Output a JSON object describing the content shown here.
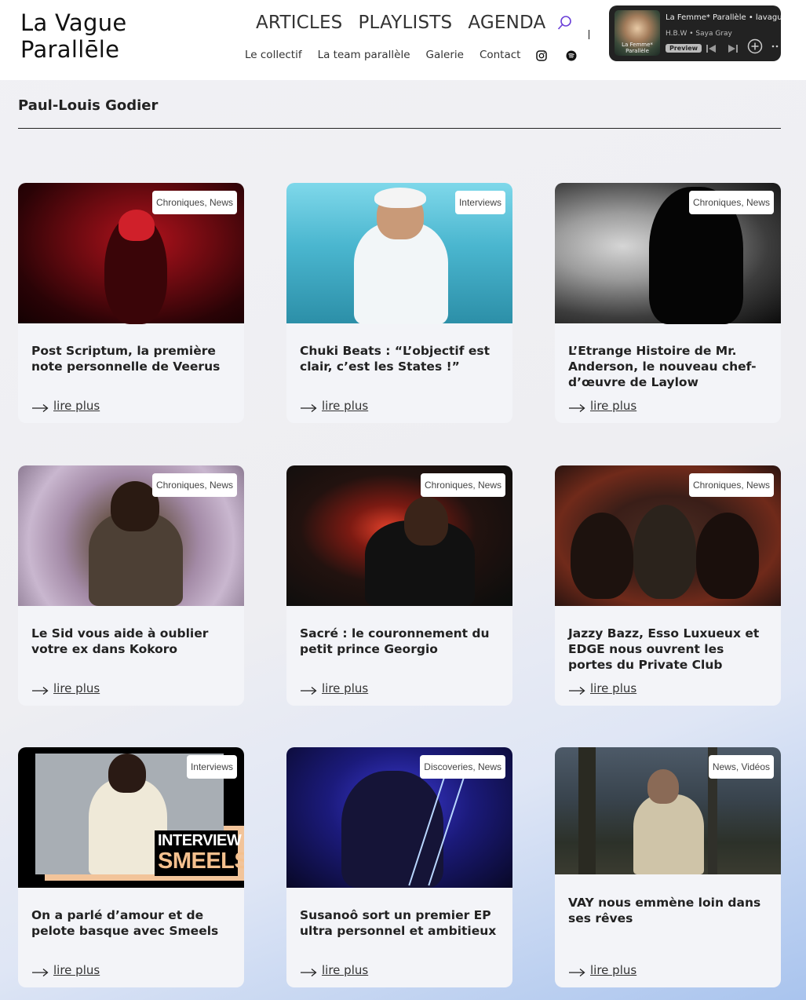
{
  "header": {
    "logo_line1": "La Vague",
    "logo_line2": "Parallēle",
    "main_nav": [
      "ARTICLES",
      "PLAYLISTS",
      "AGENDA"
    ],
    "sub_nav": [
      "Le collectif",
      "La team parallèle",
      "Galerie",
      "Contact"
    ],
    "icons": [
      "search-icon",
      "instagram-icon",
      "spotify-icon"
    ]
  },
  "player": {
    "track": "La Femme* Parallèle  •  lavaguepa",
    "artist": "H.B.W  •  Saya Gray",
    "preview": "Preview",
    "cover_text": "La Femme* Parallèle",
    "icons": [
      "previous-icon",
      "next-icon",
      "add-icon",
      "more-icon"
    ]
  },
  "page": {
    "title": "Paul-Louis Godier"
  },
  "read_more_label": "lire plus",
  "cards": [
    {
      "category": "Chroniques, News",
      "title": "Post Scriptum, la première note personnelle de Veerus"
    },
    {
      "category": "Interviews",
      "title": "Chuki Beats : “L’objectif est clair, c’est les States !”"
    },
    {
      "category": "Chroniques, News",
      "title": "L’Etrange Histoire de Mr. Anderson, le nouveau chef-d’œuvre de Laylow"
    },
    {
      "category": "Chroniques, News",
      "title": "Le Sid vous aide à oublier votre ex dans Kokoro"
    },
    {
      "category": "Chroniques, News",
      "title": "Sacré : le couronnement du petit prince Georgio"
    },
    {
      "category": "Chroniques, News",
      "title": "Jazzy Bazz, Esso Luxueux et EDGE nous ouvrent les portes du Private Club"
    },
    {
      "category": "Interviews",
      "title": "On a parlé d’amour et de pelote basque avec Smeels",
      "image_text_1": "INTERVIEW",
      "image_text_2": "SMEELS"
    },
    {
      "category": "Discoveries, News",
      "title": "Susanoô sort un premier EP ultra personnel et ambitieux"
    },
    {
      "category": "News, Vidéos",
      "title": "VAY nous emmène loin dans ses rêves"
    }
  ]
}
